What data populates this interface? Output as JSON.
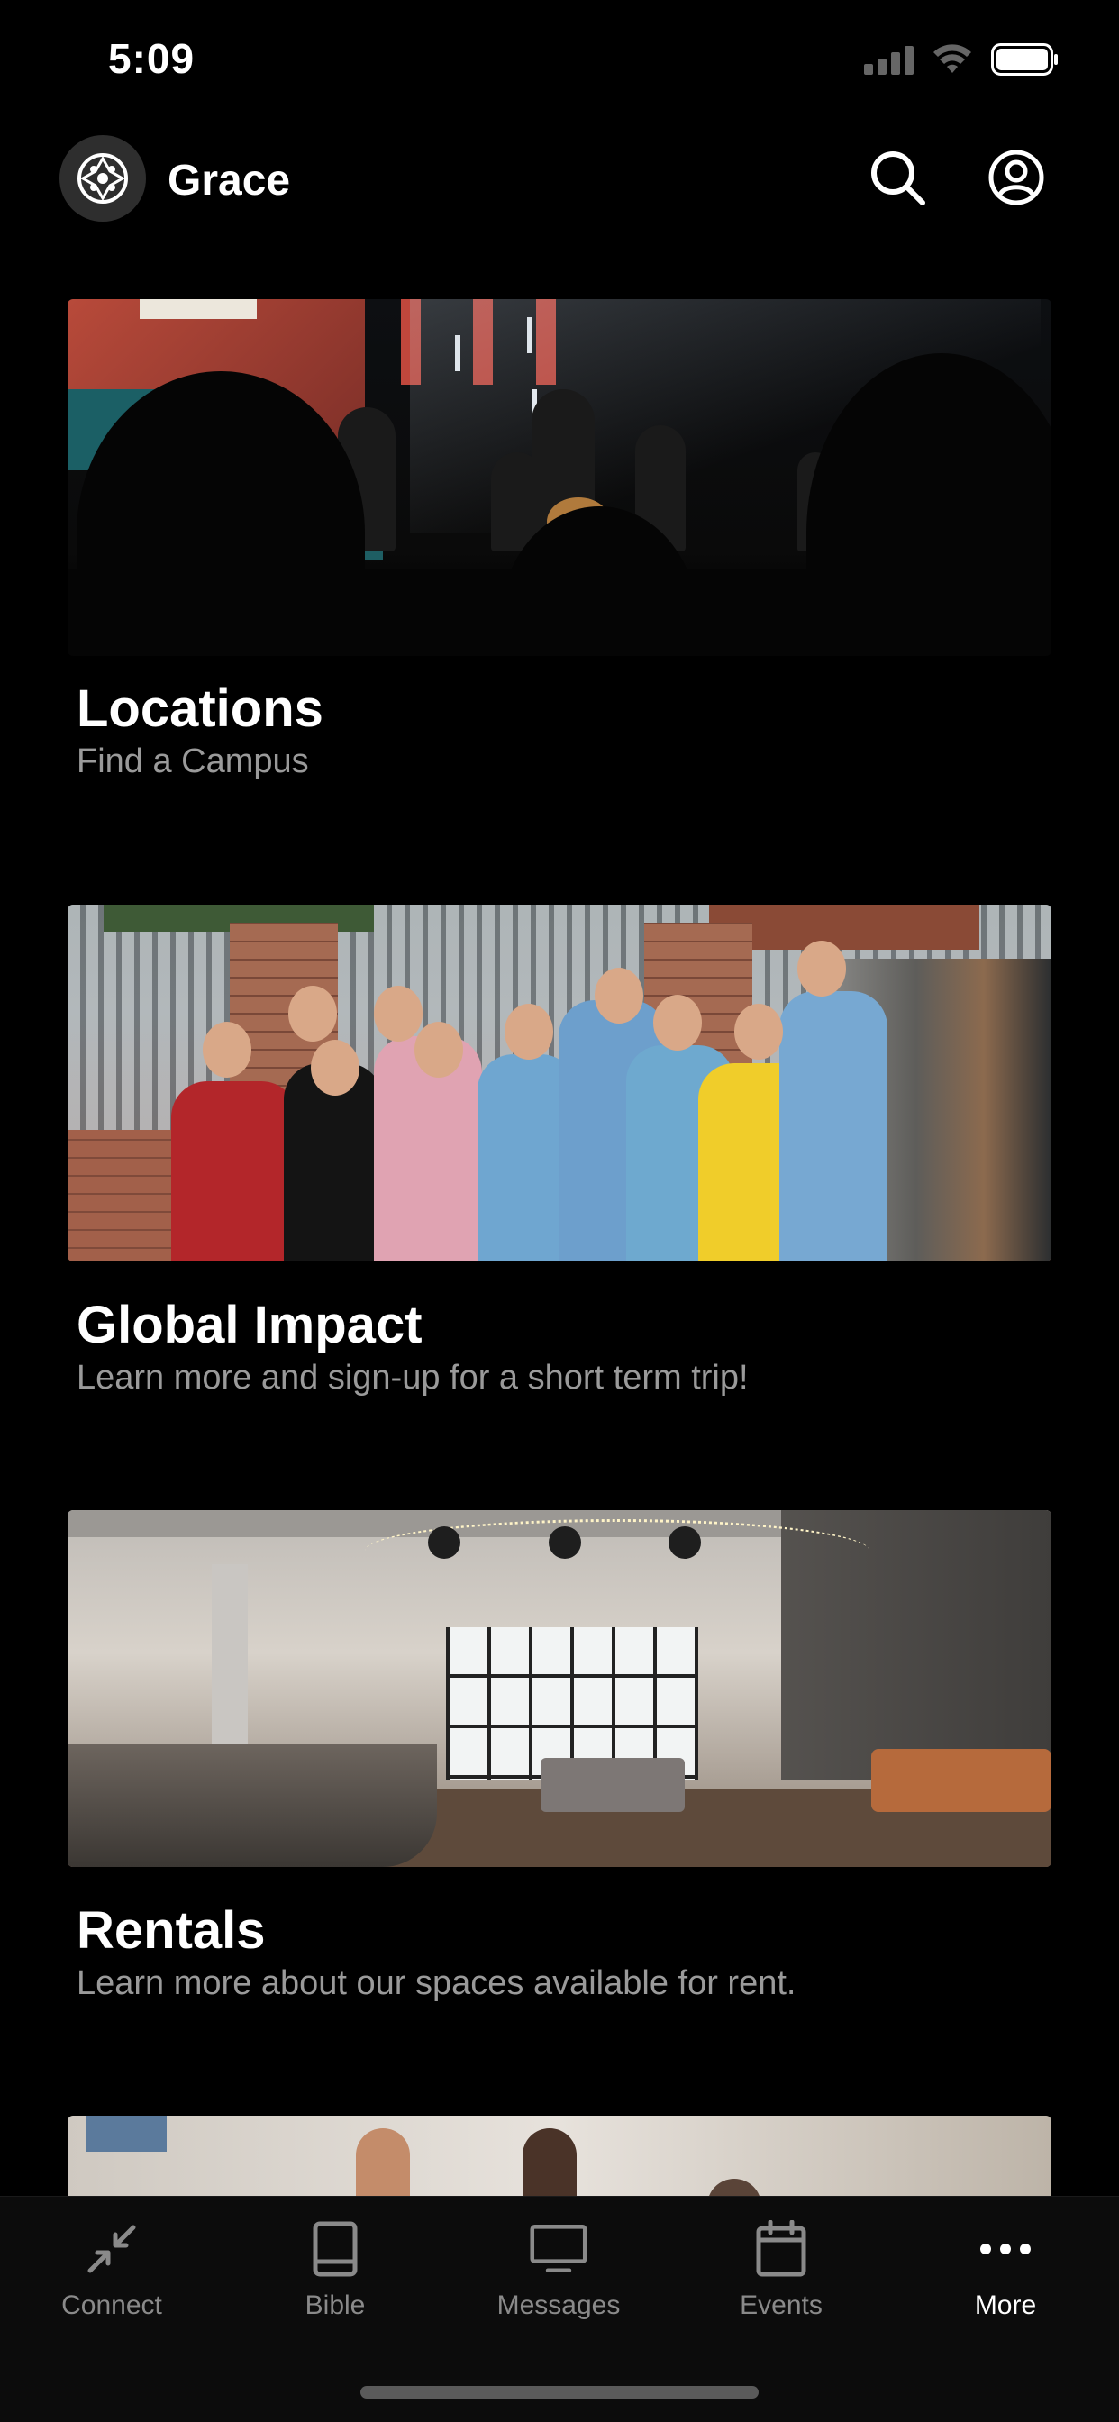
{
  "status_bar": {
    "time": "5:09"
  },
  "header": {
    "app_title": "Grace",
    "logo_icon": "grace-logo-icon",
    "search_icon": "search-icon",
    "profile_icon": "user-profile-icon"
  },
  "cards": [
    {
      "title": "Locations",
      "subtitle": "Find a Campus",
      "image": "worship-band-on-stage-photo"
    },
    {
      "title": "Global Impact",
      "subtitle": "Learn more and sign-up for a short term trip!",
      "image": "mission-team-group-photo"
    },
    {
      "title": "Rentals",
      "subtitle": "Learn more about our spaces available for rent.",
      "image": "church-lobby-cafe-photo"
    },
    {
      "image": "people-in-lobby-photo"
    }
  ],
  "tabs": [
    {
      "label": "Connect",
      "icon": "connect-arrows-icon",
      "active": false
    },
    {
      "label": "Bible",
      "icon": "book-icon",
      "active": false
    },
    {
      "label": "Messages",
      "icon": "monitor-icon",
      "active": false
    },
    {
      "label": "Events",
      "icon": "calendar-icon",
      "active": false
    },
    {
      "label": "More",
      "icon": "more-dots-icon",
      "active": true
    }
  ],
  "colors": {
    "background": "#000000",
    "subtitle_text": "#9a9a9a",
    "inactive_tab": "#8a8a8a",
    "active_tab": "#ffffff"
  }
}
